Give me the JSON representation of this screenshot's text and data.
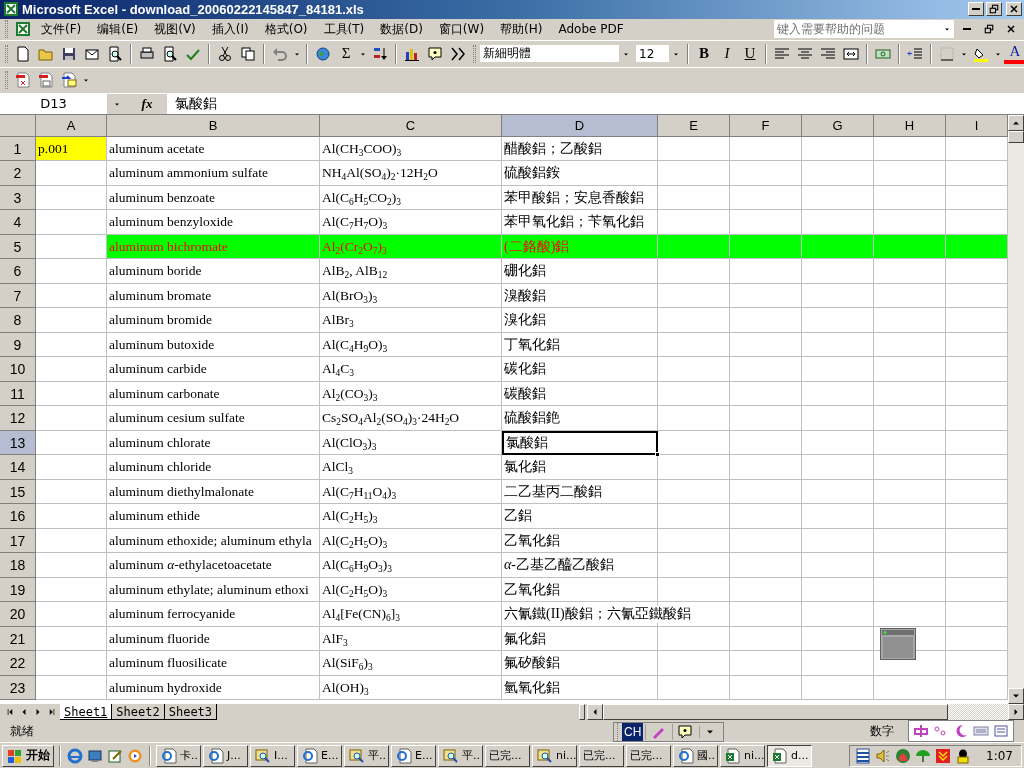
{
  "window": {
    "title": "Microsoft Excel - download_20060222145847_84181.xls"
  },
  "menu": [
    "文件(F)",
    "编辑(E)",
    "视图(V)",
    "插入(I)",
    "格式(O)",
    "工具(T)",
    "数据(D)",
    "窗口(W)",
    "帮助(H)",
    "Adobe PDF"
  ],
  "help_search": {
    "placeholder": "键入需要帮助的问题"
  },
  "toolbar": {
    "sum_label": "Σ",
    "font": "新細明體",
    "size": "12",
    "bold_label": "B",
    "italic_label": "I",
    "underline_label": "U",
    "font_color_label": "A"
  },
  "formula_bar": {
    "name_box": "D13",
    "fx_label": "fx",
    "formula": "氯酸鋁"
  },
  "columns": [
    {
      "label": "A",
      "selected": false
    },
    {
      "label": "B",
      "selected": false
    },
    {
      "label": "C",
      "selected": false
    },
    {
      "label": "D",
      "selected": true
    },
    {
      "label": "E",
      "selected": false
    },
    {
      "label": "F",
      "selected": false
    },
    {
      "label": "G",
      "selected": false
    },
    {
      "label": "H",
      "selected": false
    },
    {
      "label": "I",
      "selected": false
    }
  ],
  "rows": [
    {
      "num": "1",
      "a": {
        "text": "p.001",
        "color": "#ffff00"
      },
      "b": "aluminum acetate",
      "c": "Al(CH$_{3}$COO)$_{3}$",
      "d": "醋酸鋁；乙酸鋁",
      "highlight": false,
      "selected": false
    },
    {
      "num": "2",
      "b": "aluminum ammonium sulfate",
      "c": "NH$_{4}$Al(SO$_{4}$)$_{2}$·12H$_{2}$O",
      "d": "硫酸鋁銨",
      "highlight": false,
      "selected": false
    },
    {
      "num": "3",
      "b": "aluminum benzoate",
      "c": "Al(C$_{6}$H$_{5}$CO$_{2}$)$_{3}$",
      "d": "苯甲酸鋁；安息香酸鋁",
      "highlight": false,
      "selected": false
    },
    {
      "num": "4",
      "b": "aluminum benzyloxide",
      "c": "Al(C$_{7}$H$_{7}$O)$_{3}$",
      "d": "苯甲氧化鋁；苄氧化鋁",
      "highlight": false,
      "selected": false
    },
    {
      "num": "5",
      "b": "aluminum bichromate",
      "c": "Al$_{2}$(Cr$_{2}$O$_{7}$)$_{3}$",
      "d": "(二鉻酸)鋁",
      "highlight": true,
      "selected": false
    },
    {
      "num": "6",
      "b": "aluminum boride",
      "c": "AlB$_{2}$, AlB$_{12}$",
      "d": "硼化鋁",
      "highlight": false,
      "selected": false
    },
    {
      "num": "7",
      "b": "aluminum bromate",
      "c": "Al(BrO$_{3}$)$_{3}$",
      "d": "溴酸鋁",
      "highlight": false,
      "selected": false
    },
    {
      "num": "8",
      "b": "aluminum bromide",
      "c": "AlBr$_{3}$",
      "d": "溴化鋁",
      "highlight": false,
      "selected": false
    },
    {
      "num": "9",
      "b": "aluminum butoxide",
      "c": "Al(C$_{4}$H$_{9}$O)$_{3}$",
      "d": "丁氧化鋁",
      "highlight": false,
      "selected": false
    },
    {
      "num": "10",
      "b": "aluminum carbide",
      "c": "Al$_{4}$C$_{3}$",
      "d": "碳化鋁",
      "highlight": false,
      "selected": false
    },
    {
      "num": "11",
      "b": "aluminum carbonate",
      "c": "Al$_{2}$(CO$_{3}$)$_{3}$",
      "d": "碳酸鋁",
      "highlight": false,
      "selected": false
    },
    {
      "num": "12",
      "b": "aluminum cesium sulfate",
      "c": "Cs$_{2}$SO$_{4}$Al$_{2}$(SO$_{4}$)$_{3}$·24H$_{2}$O",
      "d": "硫酸鋁銫",
      "highlight": false,
      "selected": false
    },
    {
      "num": "13",
      "b": "aluminum chlorate",
      "c": "Al(ClO$_{3}$)$_{3}$",
      "d": "氯酸鋁",
      "highlight": false,
      "selected": true
    },
    {
      "num": "14",
      "b": "aluminum chloride",
      "c": "AlCl$_{3}$",
      "d": "氯化鋁",
      "highlight": false,
      "selected": false
    },
    {
      "num": "15",
      "b": "aluminum diethylmalonate",
      "c": "Al(C$_{7}$H$_{11}$O$_{4}$)$_{3}$",
      "d": "二乙基丙二酸鋁",
      "highlight": false,
      "selected": false
    },
    {
      "num": "16",
      "b": "aluminum ethide",
      "c": "Al(C$_{2}$H$_{5}$)$_{3}$",
      "d": "乙鋁",
      "highlight": false,
      "selected": false
    },
    {
      "num": "17",
      "b": "aluminum ethoxide; aluminum ethyla",
      "c": "Al(C$_{2}$H$_{5}$O)$_{3}$",
      "d": "乙氧化鋁",
      "highlight": false,
      "selected": false
    },
    {
      "num": "18",
      "b": "aluminum *α*-ethylacetoacetate",
      "c": "Al(C$_{6}$H$_{9}$O$_{3}$)$_{3}$",
      "d": "*α*-乙基乙醯乙酸鋁",
      "highlight": false,
      "selected": false
    },
    {
      "num": "19",
      "b": "aluminum ethylate; aluminum ethoxi",
      "c": "Al(C$_{2}$H$_{5}$O)$_{3}$",
      "d": "乙氧化鋁",
      "highlight": false,
      "selected": false
    },
    {
      "num": "20",
      "b": "aluminum ferrocyanide",
      "c": "Al$_{4}$[Fe(CN)$_{6}$]$_{3}$",
      "d": "六氰鐵(II)酸鋁；六氰亞鐵酸鋁",
      "highlight": false,
      "selected": false
    },
    {
      "num": "21",
      "b": "aluminum fluoride",
      "c": "AlF$_{3}$",
      "d": "氟化鋁",
      "highlight": false,
      "selected": false
    },
    {
      "num": "22",
      "b": "aluminum fluosilicate",
      "c": "Al(SiF$_{6}$)$_{3}$",
      "d": "氟矽酸鋁",
      "highlight": false,
      "selected": false
    },
    {
      "num": "23",
      "b": "aluminum hydroxide",
      "c": "Al(OH)$_{3}$",
      "d": "氫氧化鋁",
      "highlight": false,
      "selected": false
    }
  ],
  "sheet_tabs": [
    {
      "label": "Sheet1",
      "selected": true
    },
    {
      "label": "Sheet2",
      "selected": false
    },
    {
      "label": "Sheet3",
      "selected": false
    }
  ],
  "language_bar": {
    "label": "CH"
  },
  "status_bar": {
    "left": "就绪",
    "mode": "数字"
  },
  "taskbar": {
    "start": "开始",
    "tasks": [
      {
        "label": "卡..",
        "kind": "browser",
        "selected": false
      },
      {
        "label": "J...",
        "kind": "browser",
        "selected": false
      },
      {
        "label": "I...",
        "kind": "search",
        "selected": false
      },
      {
        "label": "E...",
        "kind": "browser",
        "selected": false
      },
      {
        "label": "平..",
        "kind": "search",
        "selected": false
      },
      {
        "label": "E...",
        "kind": "browser",
        "selected": false
      },
      {
        "label": "平..",
        "kind": "search",
        "selected": false
      },
      {
        "label": "已完...",
        "kind": "plain",
        "selected": false
      },
      {
        "label": "ni...",
        "kind": "search",
        "selected": false
      },
      {
        "label": "已完...",
        "kind": "plain",
        "selected": false
      },
      {
        "label": "已完...",
        "kind": "plain",
        "selected": false
      },
      {
        "label": "國..",
        "kind": "browser",
        "selected": false
      },
      {
        "label": "ni...",
        "kind": "spreadsheet",
        "selected": false
      },
      {
        "label": "d...",
        "kind": "spreadsheet",
        "selected": true
      }
    ],
    "clock": "1:07"
  }
}
